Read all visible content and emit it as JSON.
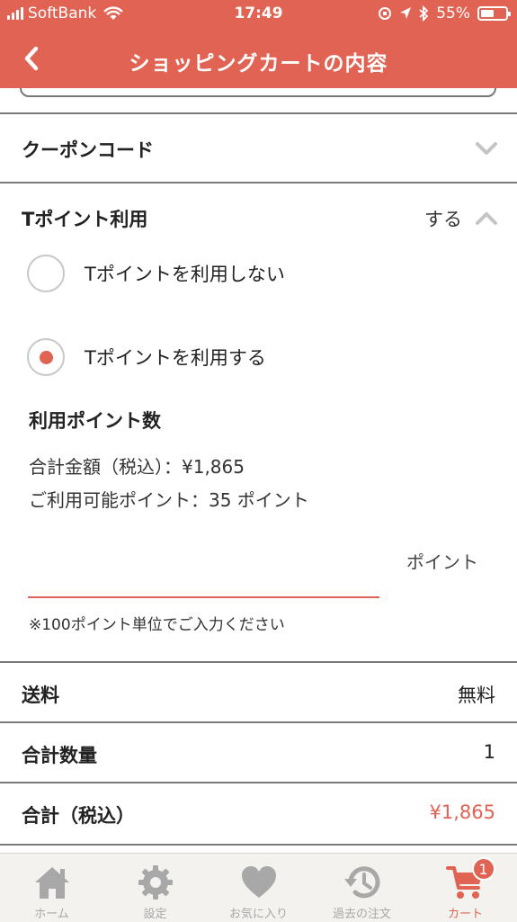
{
  "status_bar": {
    "carrier": "SoftBank",
    "time": "17:49",
    "battery": "55%",
    "battery_level": 0.55
  },
  "nav": {
    "title": "ショッピングカートの内容",
    "back_icon": "chevron-left-icon"
  },
  "coupon": {
    "label": "クーポンコード",
    "icon": "chevron-down-icon"
  },
  "tpoint": {
    "label": "Tポイント利用",
    "value": "する",
    "icon": "chevron-up-icon",
    "options": [
      {
        "label": "Tポイントを利用しない",
        "selected": false
      },
      {
        "label": "Tポイントを利用する",
        "selected": true
      }
    ],
    "usage_heading": "利用ポイント数",
    "total_line": "合計金額（税込）：¥1,865",
    "available_line": "ご利用可能ポイント：35 ポイント",
    "input_value": "",
    "input_unit": "ポイント",
    "note": "※100ポイント単位でご入力ください"
  },
  "summary": {
    "shipping_label": "送料",
    "shipping_value": "無料",
    "quantity_label": "合計数量",
    "quantity_value": "1",
    "total_label": "合計（税込）",
    "total_value": "¥1,865"
  },
  "tabbar": {
    "items": [
      {
        "label": "ホーム",
        "icon": "home-icon"
      },
      {
        "label": "設定",
        "icon": "gear-icon"
      },
      {
        "label": "お気に入り",
        "icon": "heart-icon"
      },
      {
        "label": "過去の注文",
        "icon": "history-icon"
      },
      {
        "label": "カート",
        "icon": "cart-icon",
        "badge": "1",
        "active": true
      }
    ]
  },
  "colors": {
    "accent": "#e06353",
    "tab_inactive": "#a8a8a8",
    "tabbar_bg": "#f4f2ee"
  }
}
